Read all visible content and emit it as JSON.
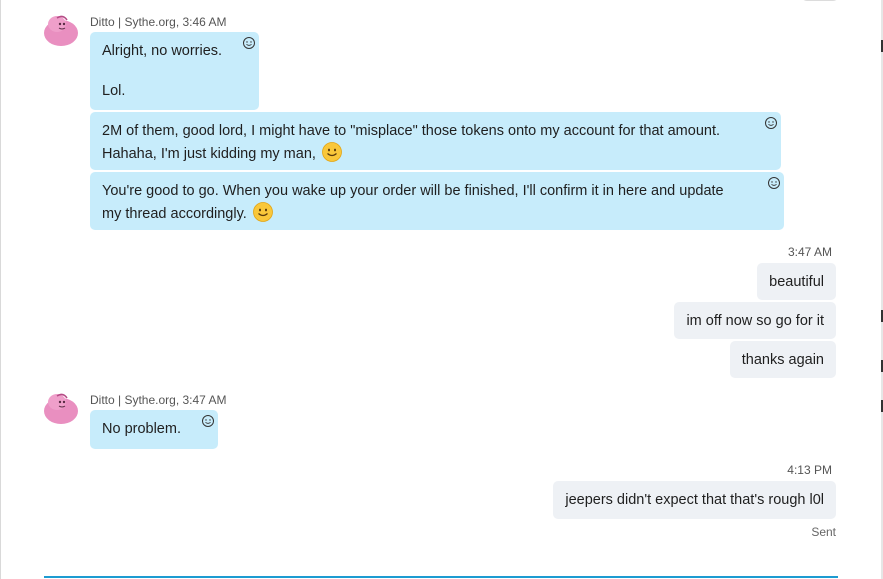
{
  "colors": {
    "incoming_bubble": "#c7ecfb",
    "outgoing_bubble": "#eef1f5",
    "composer_accent": "#1d9bd1"
  },
  "group1": {
    "sender": "Ditto | Sythe.org",
    "time": "3:46 AM",
    "msg1_line1": "Alright, no worries.",
    "msg1_line2": "Lol.",
    "msg2_line1": "2M of them, good lord, I might have to \"misplace\" those tokens onto my account for that amount.",
    "msg2_line2": "Hahaha, I'm just kidding my man,",
    "msg3_line1": "You're good to go. When you wake up your order will be finished, I'll confirm it in here and update",
    "msg3_line2": "my thread accordingly."
  },
  "outgoing1": {
    "time": "3:47 AM",
    "msg1": "beautiful",
    "msg2": "im off now so go for it",
    "msg3": "thanks again"
  },
  "group2": {
    "sender": "Ditto | Sythe.org",
    "time": "3:47 AM",
    "msg1": "No problem."
  },
  "outgoing2": {
    "time": "4:13 PM",
    "msg1": "jeepers didn't expect that that's rough l0l",
    "status": "Sent"
  },
  "icons": {
    "avatar": "avatar-pink-blob",
    "reaction": "smiley-reaction-icon",
    "emoji": "smile-emoji"
  }
}
